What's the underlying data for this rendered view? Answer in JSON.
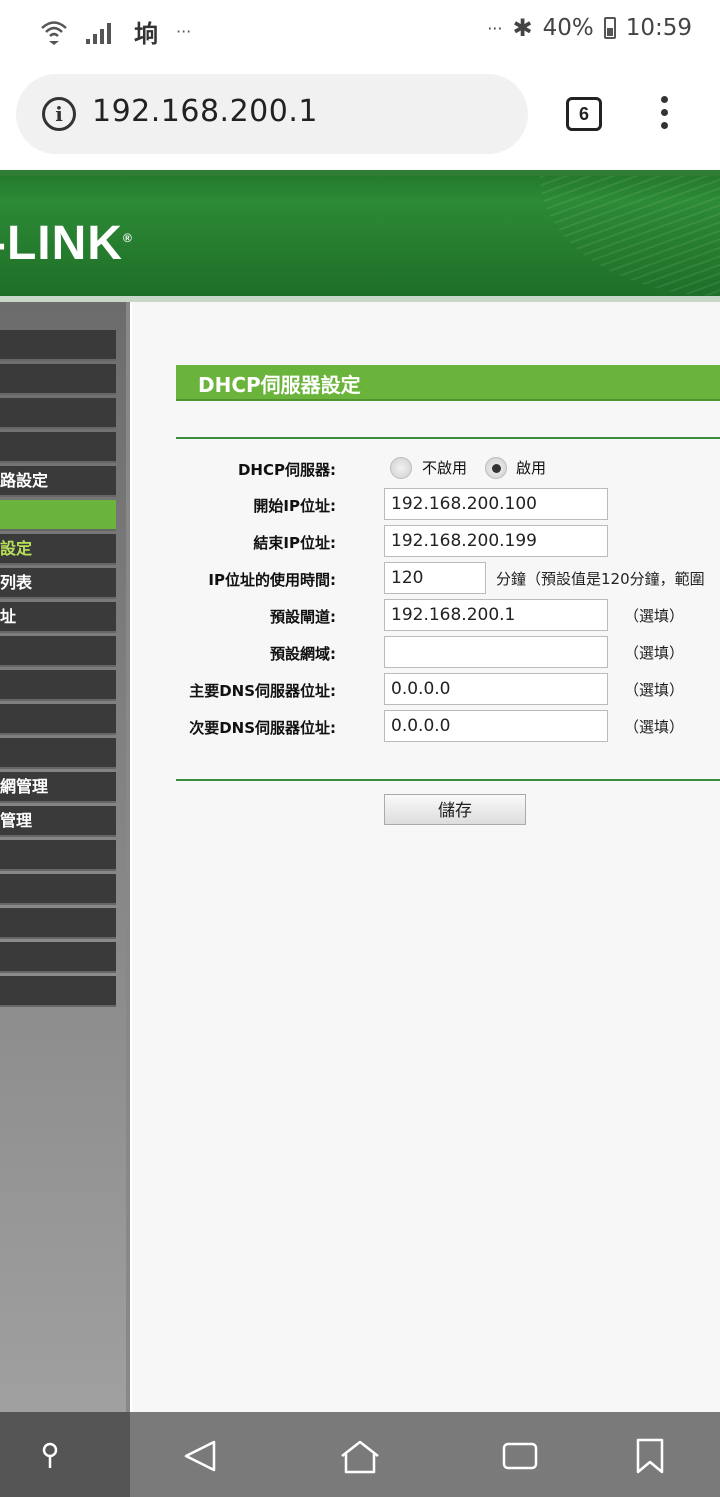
{
  "status_bar": {
    "left_icons": [
      "wifi-icon",
      "signal-icon",
      "app-notification-icon",
      "more-icon"
    ],
    "notification_glyph": "垧",
    "more_left": "···",
    "more_right": "···",
    "battery": "40%",
    "time": "10:59"
  },
  "browser": {
    "url": "192.168.200.1",
    "tab_count": "6"
  },
  "header": {
    "logo": "-LINK"
  },
  "sidebar": {
    "items": [
      {
        "label": "",
        "state": "normal"
      },
      {
        "label": "",
        "state": "normal"
      },
      {
        "label": "",
        "state": "normal"
      },
      {
        "label": "",
        "state": "normal"
      },
      {
        "label": "路設定",
        "state": "normal"
      },
      {
        "label": "",
        "state": "active"
      },
      {
        "label": "設定",
        "state": "sub"
      },
      {
        "label": "列表",
        "state": "normal"
      },
      {
        "label": "址",
        "state": "normal"
      },
      {
        "label": "",
        "state": "normal"
      },
      {
        "label": "",
        "state": "normal"
      },
      {
        "label": "",
        "state": "normal"
      },
      {
        "label": "",
        "state": "normal"
      },
      {
        "label": "網管理",
        "state": "normal"
      },
      {
        "label": "管理",
        "state": "normal"
      },
      {
        "label": "",
        "state": "normal"
      },
      {
        "label": "",
        "state": "normal"
      },
      {
        "label": "",
        "state": "normal"
      },
      {
        "label": "",
        "state": "normal"
      },
      {
        "label": "",
        "state": "normal"
      }
    ]
  },
  "form": {
    "title": "DHCP伺服器設定",
    "dhcp_label": "DHCP伺服器:",
    "radio_disable": "不啟用",
    "radio_enable": "啟用",
    "selected": "啟用",
    "start_ip_label": "開始IP位址:",
    "start_ip": "192.168.200.100",
    "end_ip_label": "結束IP位址:",
    "end_ip": "192.168.200.199",
    "lease_label": "IP位址的使用時間:",
    "lease": "120",
    "lease_note": "分鐘（預設值是120分鐘，範圍",
    "gateway_label": "預設閘道:",
    "gateway": "192.168.200.1",
    "domain_label": "預設網域:",
    "domain": "",
    "dns1_label": "主要DNS伺服器位址:",
    "dns1": "0.0.0.0",
    "dns2_label": "次要DNS伺服器位址:",
    "dns2": "0.0.0.0",
    "optional": "（選填）",
    "save": "儲存"
  },
  "nav_bar": {
    "icons": [
      "pin-icon",
      "back-icon",
      "home-icon",
      "tabs-icon",
      "bookmark-icon"
    ]
  }
}
